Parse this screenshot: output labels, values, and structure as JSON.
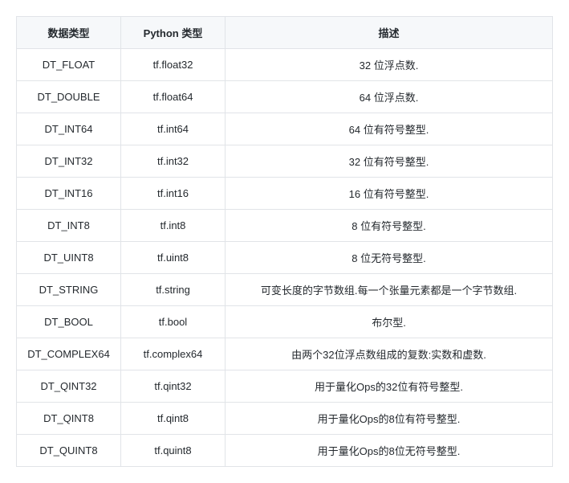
{
  "headers": {
    "datatype": "数据类型",
    "python": "Python 类型",
    "description": "描述"
  },
  "rows": [
    {
      "datatype": "DT_FLOAT",
      "python": "tf.float32",
      "description": "32 位浮点数."
    },
    {
      "datatype": "DT_DOUBLE",
      "python": "tf.float64",
      "description": "64 位浮点数."
    },
    {
      "datatype": "DT_INT64",
      "python": "tf.int64",
      "description": "64 位有符号整型."
    },
    {
      "datatype": "DT_INT32",
      "python": "tf.int32",
      "description": "32 位有符号整型."
    },
    {
      "datatype": "DT_INT16",
      "python": "tf.int16",
      "description": "16 位有符号整型."
    },
    {
      "datatype": "DT_INT8",
      "python": "tf.int8",
      "description": "8 位有符号整型."
    },
    {
      "datatype": "DT_UINT8",
      "python": "tf.uint8",
      "description": "8 位无符号整型."
    },
    {
      "datatype": "DT_STRING",
      "python": "tf.string",
      "description": "可变长度的字节数组.每一个张量元素都是一个字节数组."
    },
    {
      "datatype": "DT_BOOL",
      "python": "tf.bool",
      "description": "布尔型."
    },
    {
      "datatype": "DT_COMPLEX64",
      "python": "tf.complex64",
      "description": "由两个32位浮点数组成的复数:实数和虚数."
    },
    {
      "datatype": "DT_QINT32",
      "python": "tf.qint32",
      "description": "用于量化Ops的32位有符号整型."
    },
    {
      "datatype": "DT_QINT8",
      "python": "tf.qint8",
      "description": "用于量化Ops的8位有符号整型."
    },
    {
      "datatype": "DT_QUINT8",
      "python": "tf.quint8",
      "description": "用于量化Ops的8位无符号整型."
    }
  ]
}
